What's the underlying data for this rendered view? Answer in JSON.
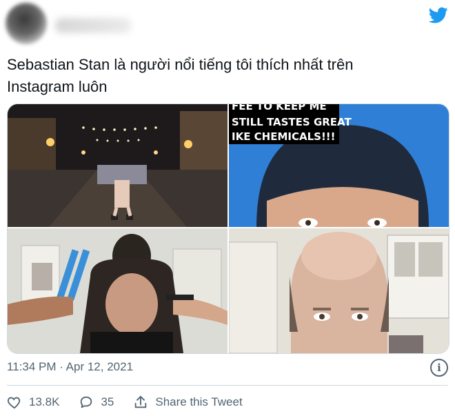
{
  "tweet": {
    "author_hidden": true,
    "text_line1": "Sebastian Stan là người nổi tiếng tôi thích nhất trên",
    "text_line2": "Instagram luôn",
    "timestamp": "11:34 PM · Apr 12, 2021"
  },
  "media": {
    "caption_lines": [
      "FEE TO KEEP ME",
      "STILL TASTES GREAT",
      "IKE CHEMICALS!!!"
    ]
  },
  "actions": {
    "likes": "13.8K",
    "replies": "35",
    "share_label": "Share this Tweet"
  },
  "icons": {
    "brand": "twitter-bird-icon",
    "info": "info-icon",
    "like": "heart-icon",
    "reply": "reply-icon",
    "share": "share-icon"
  },
  "colors": {
    "twitter_blue": "#1d9bf0",
    "secondary_text": "#536471",
    "border": "#cfd9de"
  }
}
